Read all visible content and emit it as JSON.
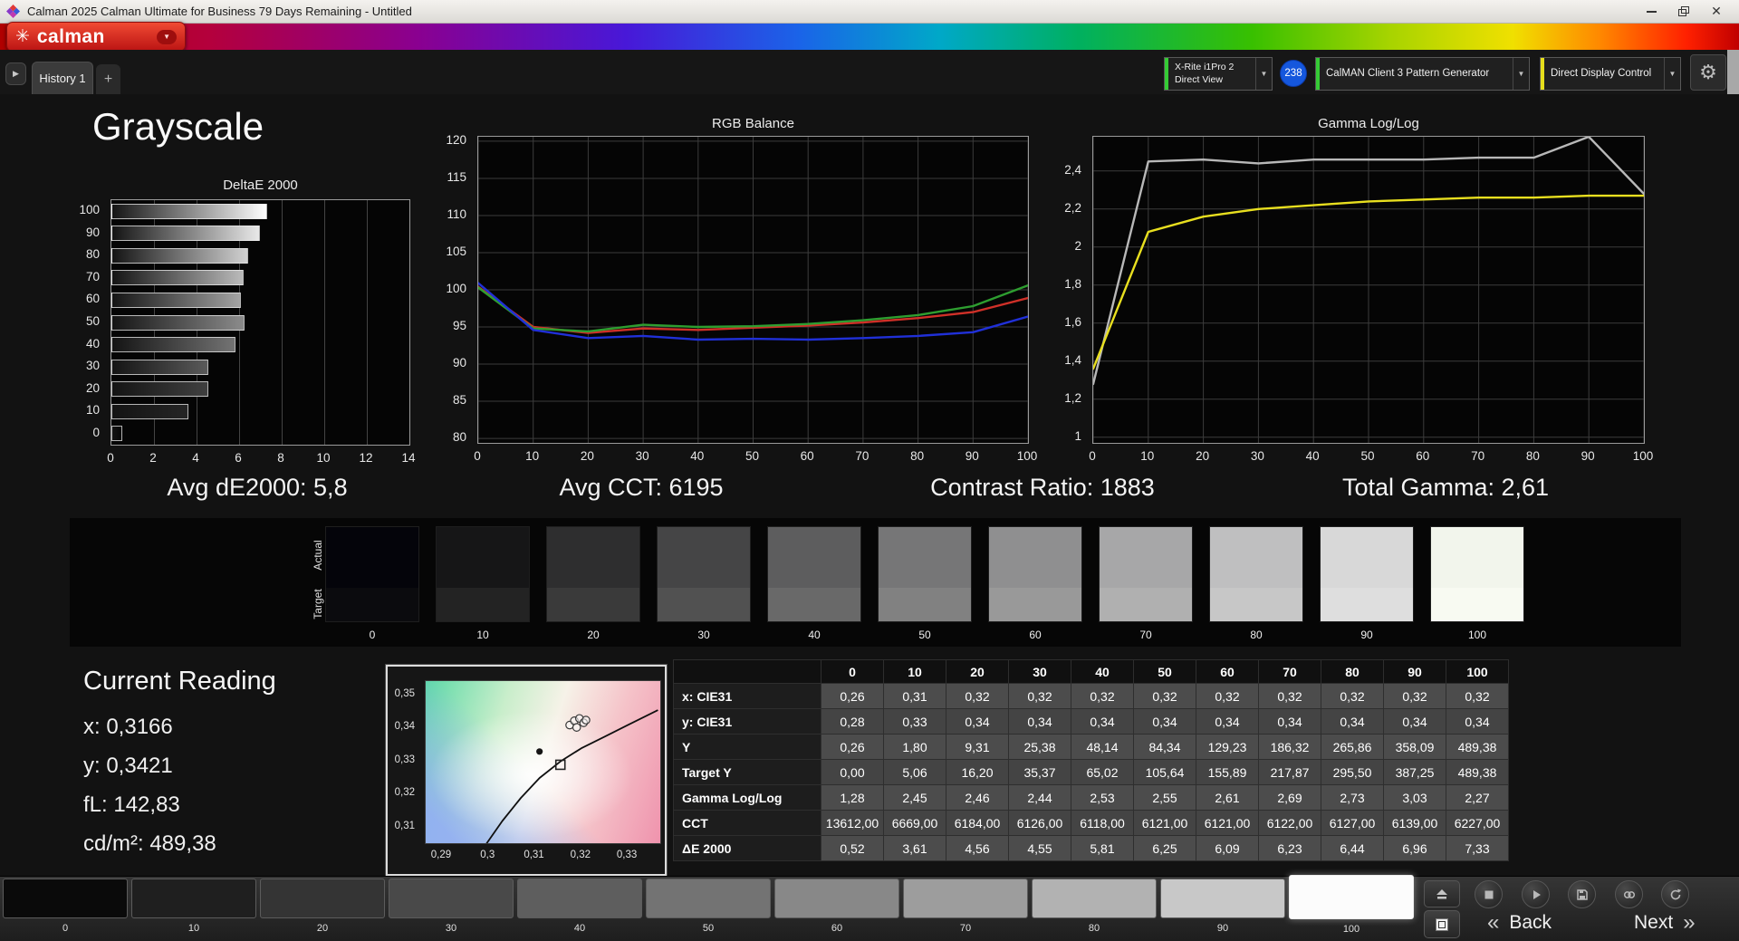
{
  "window": {
    "title": "Calman 2025 Calman Ultimate for Business 79 Days Remaining  - Untitled"
  },
  "brand": {
    "name": "calman"
  },
  "icons": {
    "gear": "⚙",
    "dropdown_arrow": "▼",
    "nav_arrow": "▶",
    "logo_flower": "✳",
    "close": "✕",
    "back_chevron": "«",
    "next_chevron": "»"
  },
  "toolbar": {
    "history_tab": "History 1",
    "add_tab_label": "+",
    "meter": {
      "line1": "X-Rite i1Pro 2",
      "line2": "Direct View"
    },
    "badge": "238",
    "pattern_generator": "CalMAN Client 3 Pattern Generator",
    "display_control": "Direct Display Control"
  },
  "page_title": "Grayscale",
  "summary": {
    "avg_de2000": "Avg dE2000: 5,8",
    "avg_cct": "Avg CCT: 6195",
    "contrast_ratio": "Contrast Ratio: 1883",
    "total_gamma": "Total Gamma: 2,61"
  },
  "swatch_strip": {
    "row_labels": [
      "Actual",
      "Target"
    ],
    "swatches": [
      {
        "label": "0",
        "actual": "#04040a",
        "target": "#0b0b0e"
      },
      {
        "label": "10",
        "actual": "#161617",
        "target": "#232323"
      },
      {
        "label": "20",
        "actual": "#2e2e2f",
        "target": "#3a3a3a"
      },
      {
        "label": "30",
        "actual": "#454546",
        "target": "#515151"
      },
      {
        "label": "40",
        "actual": "#5d5d5e",
        "target": "#696969"
      },
      {
        "label": "50",
        "actual": "#767677",
        "target": "#818181"
      },
      {
        "label": "60",
        "actual": "#8f8f90",
        "target": "#999999"
      },
      {
        "label": "70",
        "actual": "#a7a7a8",
        "target": "#b0b0b0"
      },
      {
        "label": "80",
        "actual": "#bfbfc0",
        "target": "#c7c7c7"
      },
      {
        "label": "90",
        "actual": "#d8d8d8",
        "target": "#dedede"
      },
      {
        "label": "100",
        "actual": "#f2f5ec",
        "target": "#f8faf2"
      }
    ]
  },
  "current_reading": {
    "title": "Current Reading",
    "lines": [
      "x: 0,3166",
      "y: 0,3421",
      "fL: 142,83",
      "cd/m²: 489,38"
    ]
  },
  "table": {
    "columns": [
      "0",
      "10",
      "20",
      "30",
      "40",
      "50",
      "60",
      "70",
      "80",
      "90",
      "100"
    ],
    "rows": [
      {
        "label": "x: CIE31",
        "values": [
          "0,26",
          "0,31",
          "0,32",
          "0,32",
          "0,32",
          "0,32",
          "0,32",
          "0,32",
          "0,32",
          "0,32",
          "0,32"
        ]
      },
      {
        "label": "y: CIE31",
        "values": [
          "0,28",
          "0,33",
          "0,34",
          "0,34",
          "0,34",
          "0,34",
          "0,34",
          "0,34",
          "0,34",
          "0,34",
          "0,34"
        ]
      },
      {
        "label": "Y",
        "values": [
          "0,26",
          "1,80",
          "9,31",
          "25,38",
          "48,14",
          "84,34",
          "129,23",
          "186,32",
          "265,86",
          "358,09",
          "489,38"
        ]
      },
      {
        "label": "Target Y",
        "values": [
          "0,00",
          "5,06",
          "16,20",
          "35,37",
          "65,02",
          "105,64",
          "155,89",
          "217,87",
          "295,50",
          "387,25",
          "489,38"
        ]
      },
      {
        "label": "Gamma Log/Log",
        "values": [
          "1,28",
          "2,45",
          "2,46",
          "2,44",
          "2,53",
          "2,55",
          "2,61",
          "2,69",
          "2,73",
          "3,03",
          "2,27"
        ]
      },
      {
        "label": "CCT",
        "values": [
          "13612,00",
          "6669,00",
          "6184,00",
          "6126,00",
          "6118,00",
          "6121,00",
          "6121,00",
          "6122,00",
          "6127,00",
          "6139,00",
          "6227,00"
        ]
      },
      {
        "label": "ΔE 2000",
        "values": [
          "0,52",
          "3,61",
          "4,56",
          "4,55",
          "5,81",
          "6,25",
          "6,09",
          "6,23",
          "6,44",
          "6,96",
          "7,33"
        ]
      }
    ]
  },
  "bottom_bar": {
    "back_label": "Back",
    "next_label": "Next",
    "patches": [
      {
        "label": "0",
        "color": "#0a0a0a"
      },
      {
        "label": "10",
        "color": "#1f1f1f"
      },
      {
        "label": "20",
        "color": "#343434"
      },
      {
        "label": "30",
        "color": "#494949"
      },
      {
        "label": "40",
        "color": "#5e5e5e"
      },
      {
        "label": "50",
        "color": "#737373"
      },
      {
        "label": "60",
        "color": "#888888"
      },
      {
        "label": "70",
        "color": "#9d9d9d"
      },
      {
        "label": "80",
        "color": "#b2b2b2"
      },
      {
        "label": "90",
        "color": "#c8c8c8"
      },
      {
        "label": "100",
        "color": "#fcfcfc",
        "selected": true
      }
    ]
  },
  "chart_data": [
    {
      "name": "deltae",
      "type": "bar",
      "title": "DeltaE 2000",
      "orientation": "horizontal",
      "categories": [
        100,
        90,
        80,
        70,
        60,
        50,
        40,
        30,
        20,
        10,
        0
      ],
      "values": [
        7.33,
        6.96,
        6.44,
        6.23,
        6.09,
        6.25,
        5.81,
        4.55,
        4.56,
        3.61,
        0.52
      ],
      "xlim": [
        0,
        14
      ],
      "xticks": [
        0,
        2,
        4,
        6,
        8,
        10,
        12,
        14
      ],
      "grid": "vertical"
    },
    {
      "name": "rgb_balance",
      "type": "line",
      "title": "RGB Balance",
      "x": [
        0,
        10,
        20,
        30,
        40,
        50,
        60,
        70,
        80,
        90,
        100
      ],
      "xlim": [
        0,
        100
      ],
      "xticks": [
        0,
        10,
        20,
        30,
        40,
        50,
        60,
        70,
        80,
        90,
        100
      ],
      "ylim": [
        79.4,
        120.6
      ],
      "yticks": [
        120,
        115,
        110,
        105,
        100,
        95,
        90,
        85,
        80
      ],
      "grid": "both",
      "legend": "none",
      "series": [
        {
          "name": "red",
          "color": "#d03028",
          "values": [
            100.4,
            95.0,
            94.2,
            94.8,
            94.6,
            94.9,
            95.2,
            95.6,
            96.2,
            97.0,
            98.9
          ]
        },
        {
          "name": "green",
          "color": "#2e9e30",
          "values": [
            100.3,
            94.8,
            94.4,
            95.3,
            95.0,
            95.1,
            95.4,
            95.9,
            96.6,
            97.8,
            100.6
          ]
        },
        {
          "name": "blue",
          "color": "#2030d8",
          "values": [
            100.9,
            94.6,
            93.5,
            93.8,
            93.3,
            93.4,
            93.3,
            93.5,
            93.8,
            94.3,
            96.4
          ]
        }
      ]
    },
    {
      "name": "gamma",
      "type": "line",
      "title": "Gamma Log/Log",
      "x": [
        0,
        10,
        20,
        30,
        40,
        50,
        60,
        70,
        80,
        90,
        100
      ],
      "xlim": [
        0,
        100
      ],
      "xticks": [
        0,
        10,
        20,
        30,
        40,
        50,
        60,
        70,
        80,
        90,
        100
      ],
      "ylim": [
        0.97,
        2.58
      ],
      "yticks": [
        2.4,
        2.2,
        2.0,
        1.8,
        1.6,
        1.4,
        1.2,
        1.0
      ],
      "ytick_labels": [
        "2,4",
        "2,2",
        "2",
        "1,8",
        "1,6",
        "1,4",
        "1,2",
        "1"
      ],
      "grid": "both",
      "series": [
        {
          "name": "measured-gamma",
          "color": "#b8b8b8",
          "values": [
            1.28,
            2.45,
            2.46,
            2.44,
            2.46,
            2.46,
            2.46,
            2.47,
            2.47,
            2.58,
            2.28
          ]
        },
        {
          "name": "target-gamma",
          "color": "#e8df1f",
          "values": [
            1.36,
            2.08,
            2.16,
            2.2,
            2.22,
            2.24,
            2.25,
            2.26,
            2.26,
            2.27,
            2.27
          ]
        }
      ]
    },
    {
      "name": "cie",
      "type": "scatter",
      "title": "CIE 1931 chromaticity detail",
      "xlim": [
        0.2865,
        0.337
      ],
      "ylim": [
        0.3048,
        0.3538
      ],
      "xticks": [
        0.29,
        0.3,
        0.31,
        0.32,
        0.33
      ],
      "xtick_labels": [
        "0,29",
        "0,3",
        "0,31",
        "0,32",
        "0,33"
      ],
      "yticks": [
        0.35,
        0.34,
        0.33,
        0.32,
        0.31
      ],
      "ytick_labels": [
        "0,35",
        "0,34",
        "0,33",
        "0,32",
        "0,31"
      ],
      "locus": [
        [
          0.2995,
          0.3045
        ],
        [
          0.303,
          0.3115
        ],
        [
          0.307,
          0.3185
        ],
        [
          0.311,
          0.3245
        ],
        [
          0.3155,
          0.3295
        ],
        [
          0.32,
          0.3335
        ],
        [
          0.325,
          0.337
        ],
        [
          0.33,
          0.3405
        ],
        [
          0.3365,
          0.345
        ]
      ],
      "target_square": {
        "x": 0.3155,
        "y": 0.3285
      },
      "reference_dot": {
        "x": 0.311,
        "y": 0.3325
      },
      "measurements": [
        [
          0.3175,
          0.3405
        ],
        [
          0.3185,
          0.3418
        ],
        [
          0.3196,
          0.3425
        ],
        [
          0.3205,
          0.3412
        ],
        [
          0.319,
          0.3398
        ],
        [
          0.321,
          0.342
        ]
      ]
    }
  ]
}
